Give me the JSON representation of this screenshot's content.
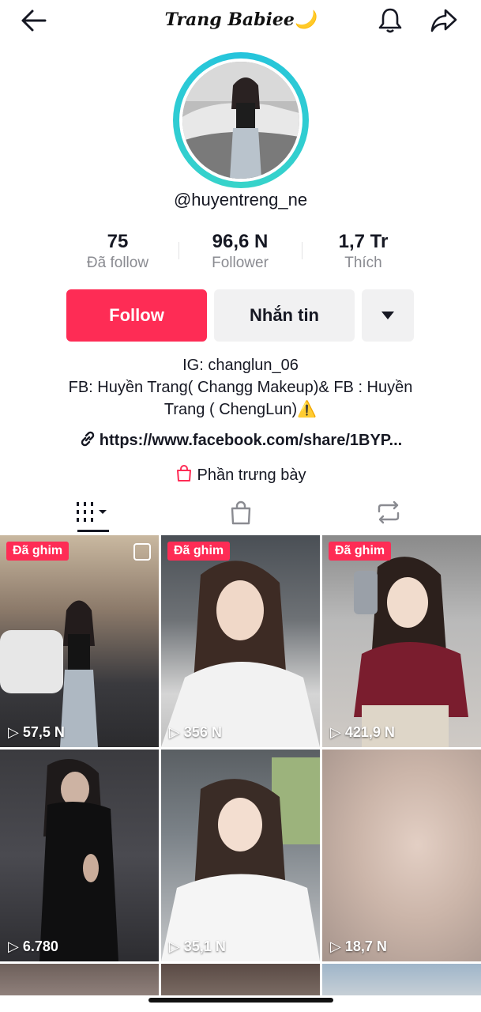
{
  "header": {
    "title": "Trang Babiee🌙"
  },
  "profile": {
    "handle": "@huyentreng_ne",
    "stats": [
      {
        "value": "75",
        "label": "Đã follow"
      },
      {
        "value": "96,6 N",
        "label": "Follower"
      },
      {
        "value": "1,7 Tr",
        "label": "Thích"
      }
    ],
    "follow_label": "Follow",
    "message_label": "Nhắn tin",
    "bio_line1": "IG: changlun_06",
    "bio_line2": "FB: Huyền Trang( Changg Makeup)& FB : Huyền",
    "bio_line3": "Trang ( ChengLun)⚠️",
    "link": "https://www.facebook.com/share/1BYP...",
    "showcase_label": "Phần trưng bày"
  },
  "videos": [
    {
      "pinned": "Đã ghim",
      "views": "57,5 N"
    },
    {
      "pinned": "Đã ghim",
      "views": "356 N"
    },
    {
      "pinned": "Đã ghim",
      "views": "421,9 N"
    },
    {
      "pinned": "",
      "views": "6.780"
    },
    {
      "pinned": "",
      "views": "35,1 N"
    },
    {
      "pinned": "",
      "views": "18,7 N"
    }
  ],
  "colors": {
    "accent": "#fe2c55",
    "ring": "#25c4dc",
    "secondary_button": "#f1f1f2"
  }
}
